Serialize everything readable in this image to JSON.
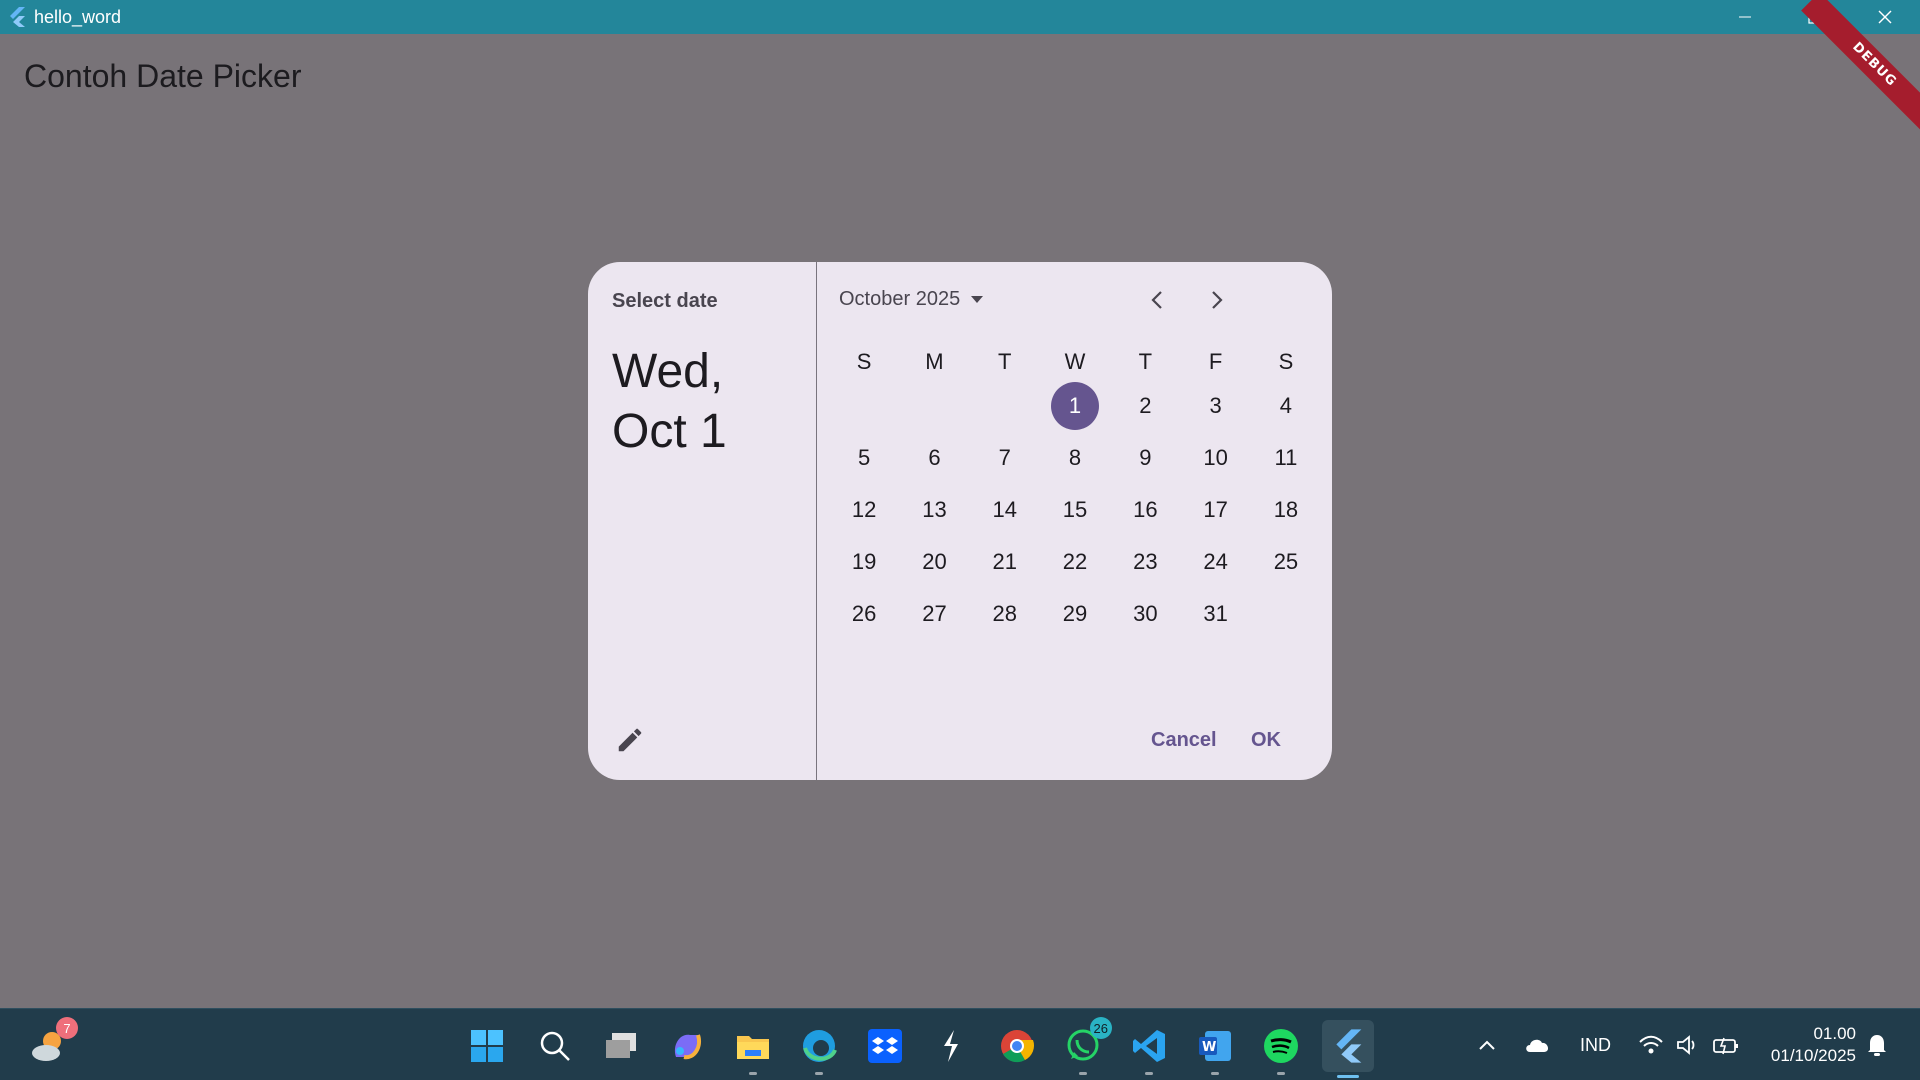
{
  "window": {
    "title": "hello_word"
  },
  "app": {
    "title": "Contoh Date Picker",
    "debug_banner": "DEBUG"
  },
  "date_picker": {
    "header_label": "Select date",
    "selected_line1": "Wed,",
    "selected_line2": "Oct 1",
    "month_label": "October 2025",
    "weekdays": [
      "S",
      "M",
      "T",
      "W",
      "T",
      "F",
      "S"
    ],
    "weeks": [
      [
        "",
        "",
        "",
        "1",
        "2",
        "3",
        "4"
      ],
      [
        "5",
        "6",
        "7",
        "8",
        "9",
        "10",
        "11"
      ],
      [
        "12",
        "13",
        "14",
        "15",
        "16",
        "17",
        "18"
      ],
      [
        "19",
        "20",
        "21",
        "22",
        "23",
        "24",
        "25"
      ],
      [
        "26",
        "27",
        "28",
        "29",
        "30",
        "31",
        ""
      ]
    ],
    "selected_day": "1",
    "cancel_label": "Cancel",
    "ok_label": "OK",
    "accent_color": "#65558f",
    "surface_color": "#ece6f0"
  },
  "taskbar": {
    "weather_badge": "7",
    "whatsapp_badge": "26",
    "language": "IND",
    "time": "01.00",
    "date": "01/10/2025"
  }
}
